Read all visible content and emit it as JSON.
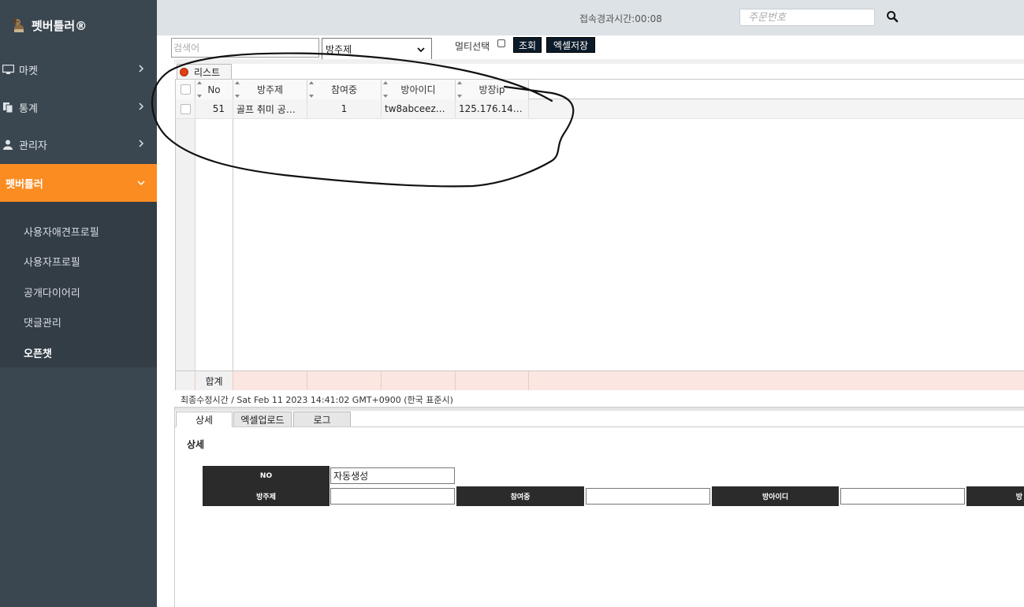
{
  "sidebar": {
    "brand": "펫버틀러®",
    "menu": [
      {
        "label": "마켓",
        "icon": "monitor-icon"
      },
      {
        "label": "통계",
        "icon": "copy-icon"
      },
      {
        "label": "관리자",
        "icon": "user-icon"
      },
      {
        "label": "펫버틀러",
        "icon": "none"
      }
    ],
    "submenu": [
      "사용자애견프로필",
      "사용자프로필",
      "공개다이어리",
      "댓글관리",
      "오픈챗"
    ],
    "active_submenu": "오픈챗",
    "accent_color": "#fb8c22",
    "bg_color": "#3a4650"
  },
  "header": {
    "elapsed_label": "접속경과시간:",
    "elapsed_value": "00:08",
    "order_placeholder": "주문번호",
    "search_icon": "search-icon"
  },
  "filters": {
    "search_placeholder": "검색어",
    "select_value": "방주제",
    "multi_label": "멀티선택",
    "query_button": "조회",
    "excel_button": "엑셀저장"
  },
  "grid": {
    "tab_label": "리스트",
    "columns": [
      "No",
      "방주제",
      "참여중",
      "방아이디",
      "방장ip"
    ],
    "rows": [
      {
        "no": "51",
        "topic": "골프 취미 공…",
        "joined": "1",
        "room_id": "tw8abceez…",
        "owner_ip": "125.176.14…"
      }
    ],
    "footer_label": "합계",
    "modified": "최종수정시간 / Sat Feb 11 2023 14:41:02 GMT+0900 (한국 표준시)"
  },
  "bottom_tabs": [
    "상세",
    "엑셀업로드",
    "로그"
  ],
  "detail": {
    "title": "상세",
    "no_label": "NO",
    "no_value": "자동생성",
    "topic_label": "방주제",
    "joined_label": "참여중",
    "room_id_label": "방아이디",
    "owner_label_partial": "방"
  }
}
